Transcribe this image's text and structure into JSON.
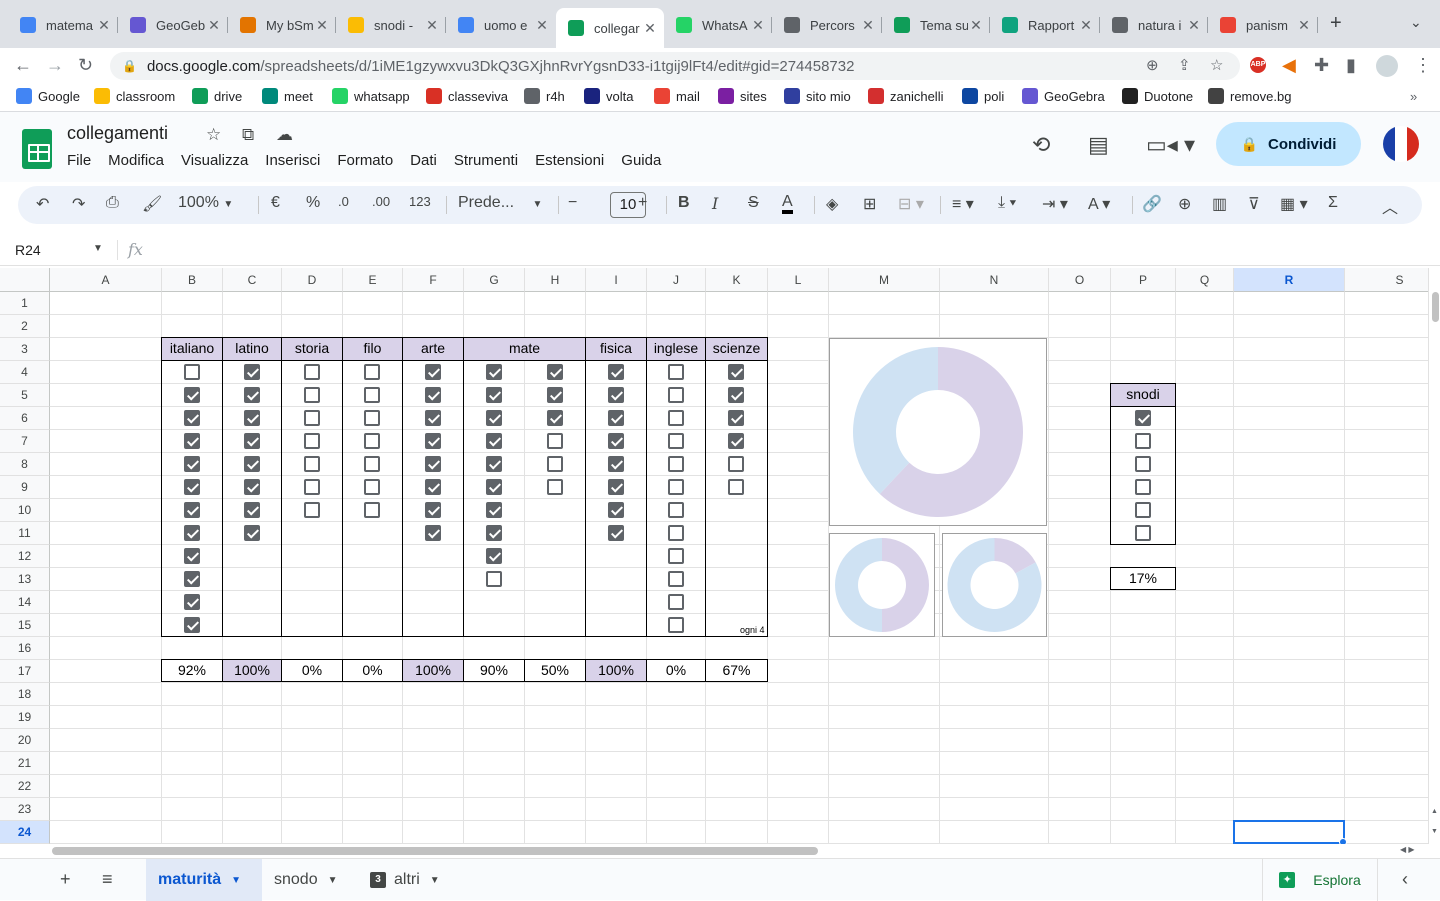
{
  "browser": {
    "tabs": [
      {
        "title": "matema",
        "fav": "docs",
        "color": "#4285f4"
      },
      {
        "title": "GeoGeb",
        "fav": "geogebra",
        "color": "#6557d2"
      },
      {
        "title": "My bSm",
        "fav": "bsmart",
        "color": "#e37400"
      },
      {
        "title": "snodi -",
        "fav": "drive",
        "color": "#fbbc04"
      },
      {
        "title": "uomo e",
        "fav": "docs",
        "color": "#4285f4"
      },
      {
        "title": "collegar",
        "fav": "sheets",
        "color": "#0f9d58"
      },
      {
        "title": "WhatsA",
        "fav": "whatsapp",
        "color": "#25d366"
      },
      {
        "title": "Percors",
        "fav": "globe",
        "color": "#5f6368"
      },
      {
        "title": "Tema su",
        "fav": "dollar",
        "color": "#0f9d58"
      },
      {
        "title": "Rapport",
        "fav": "chatgpt",
        "color": "#10a37f"
      },
      {
        "title": "natura i",
        "fav": "t-square",
        "color": "#5f6368"
      },
      {
        "title": "panism",
        "fav": "google",
        "color": "#ea4335"
      }
    ],
    "url_host": "docs.google.com",
    "url_path": "/spreadsheets/d/1iME1gzywxvu3DkQ3GXjhnRvrYgsnD33-i1tgij9lFt4/edit#gid=274458732",
    "bookmarks": [
      {
        "label": "Google",
        "color": "#4285f4"
      },
      {
        "label": "classroom",
        "color": "#fbbc04"
      },
      {
        "label": "drive",
        "color": "#0f9d58"
      },
      {
        "label": "meet",
        "color": "#00897b"
      },
      {
        "label": "whatsapp",
        "color": "#25d366"
      },
      {
        "label": "classeviva",
        "color": "#d93025"
      },
      {
        "label": "r4h",
        "color": "#5f6368"
      },
      {
        "label": "volta",
        "color": "#1a237e"
      },
      {
        "label": "mail",
        "color": "#ea4335"
      },
      {
        "label": "sites",
        "color": "#7b1fa2"
      },
      {
        "label": "sito mio",
        "color": "#303f9f"
      },
      {
        "label": "zanichelli",
        "color": "#d32f2f"
      },
      {
        "label": "poli",
        "color": "#0d47a1"
      },
      {
        "label": "GeoGebra",
        "color": "#6557d2"
      },
      {
        "label": "Duotone",
        "color": "#212121"
      },
      {
        "label": "remove.bg",
        "color": "#424242"
      }
    ]
  },
  "app": {
    "title": "collegamenti",
    "menu": [
      "File",
      "Modifica",
      "Visualizza",
      "Inserisci",
      "Formato",
      "Dati",
      "Strumenti",
      "Estensioni",
      "Guida"
    ],
    "share_label": "Condividi"
  },
  "toolbar": {
    "zoom": "100%",
    "currency": "€",
    "percent": "%",
    "dec_less": ".0",
    "dec_more": ".00",
    "format_num": "123",
    "font": "Prede...",
    "font_size": "10"
  },
  "formula_bar": {
    "cell_ref": "R24",
    "fx": "fx",
    "content": ""
  },
  "sheet": {
    "columns": [
      "A",
      "B",
      "C",
      "D",
      "E",
      "F",
      "G",
      "H",
      "I",
      "J",
      "K",
      "L",
      "M",
      "N",
      "O",
      "P",
      "Q",
      "R",
      "S"
    ],
    "rows": [
      "1",
      "2",
      "3",
      "4",
      "5",
      "6",
      "7",
      "8",
      "9",
      "10",
      "11",
      "12",
      "13",
      "14",
      "15",
      "16",
      "17",
      "18",
      "19",
      "20",
      "21",
      "22",
      "23",
      "24"
    ],
    "selected_column": "R",
    "selected_row": "24",
    "subjects": [
      {
        "label": "italiano",
        "cols": 1
      },
      {
        "label": "latino",
        "cols": 1
      },
      {
        "label": "storia",
        "cols": 1
      },
      {
        "label": "filo",
        "cols": 1
      },
      {
        "label": "arte",
        "cols": 1
      },
      {
        "label": "mate",
        "cols": 2
      },
      {
        "label": "fisica",
        "cols": 1
      },
      {
        "label": "inglese",
        "cols": 1
      },
      {
        "label": "scienze",
        "cols": 1
      }
    ],
    "checkbox_columns": [
      [
        false,
        true,
        true,
        true,
        true,
        true,
        true,
        true,
        true,
        true,
        true,
        true
      ],
      [
        true,
        true,
        true,
        true,
        true,
        true,
        true,
        true
      ],
      [
        false,
        false,
        false,
        false,
        false,
        false,
        false
      ],
      [
        false,
        false,
        false,
        false,
        false,
        false,
        false
      ],
      [
        true,
        true,
        true,
        true,
        true,
        true,
        true,
        true
      ],
      [
        true,
        true,
        true,
        true,
        true,
        true,
        true,
        true,
        true,
        false
      ],
      [
        true,
        true,
        true,
        false,
        false,
        false
      ],
      [
        true,
        true,
        true,
        true,
        true,
        true,
        true,
        true
      ],
      [
        false,
        false,
        false,
        false,
        false,
        false,
        false,
        false,
        false,
        false,
        false,
        false
      ],
      [
        true,
        true,
        true,
        true,
        false,
        false
      ]
    ],
    "note": "ogni 4",
    "percentages": [
      {
        "value": "92%",
        "highlight": false
      },
      {
        "value": "100%",
        "highlight": true
      },
      {
        "value": "0%",
        "highlight": false
      },
      {
        "value": "0%",
        "highlight": false
      },
      {
        "value": "100%",
        "highlight": true
      },
      {
        "value": "90%",
        "highlight": false
      },
      {
        "value": "50%",
        "highlight": false
      },
      {
        "value": "100%",
        "highlight": true
      },
      {
        "value": "0%",
        "highlight": false
      },
      {
        "value": "67%",
        "highlight": false
      }
    ],
    "snodi": {
      "label": "snodi",
      "checks": [
        true,
        false,
        false,
        false,
        false,
        false
      ],
      "percent": "17%"
    }
  },
  "chart_data": [
    {
      "type": "pie",
      "donut": true,
      "slices": [
        {
          "value": 62,
          "color": "#d9d2e9"
        },
        {
          "value": 38,
          "color": "#cfe2f3"
        }
      ]
    },
    {
      "type": "pie",
      "donut": true,
      "slices": [
        {
          "value": 50,
          "color": "#d9d2e9"
        },
        {
          "value": 50,
          "color": "#cfe2f3"
        }
      ]
    },
    {
      "type": "pie",
      "donut": true,
      "slices": [
        {
          "value": 17,
          "color": "#d9d2e9"
        },
        {
          "value": 83,
          "color": "#cfe2f3"
        }
      ]
    }
  ],
  "sheet_tabs": [
    {
      "label": "maturità",
      "active": true,
      "badge": ""
    },
    {
      "label": "snodo",
      "active": false,
      "badge": ""
    },
    {
      "label": "altri",
      "active": false,
      "badge": "3"
    }
  ],
  "explore_label": "Esplora"
}
